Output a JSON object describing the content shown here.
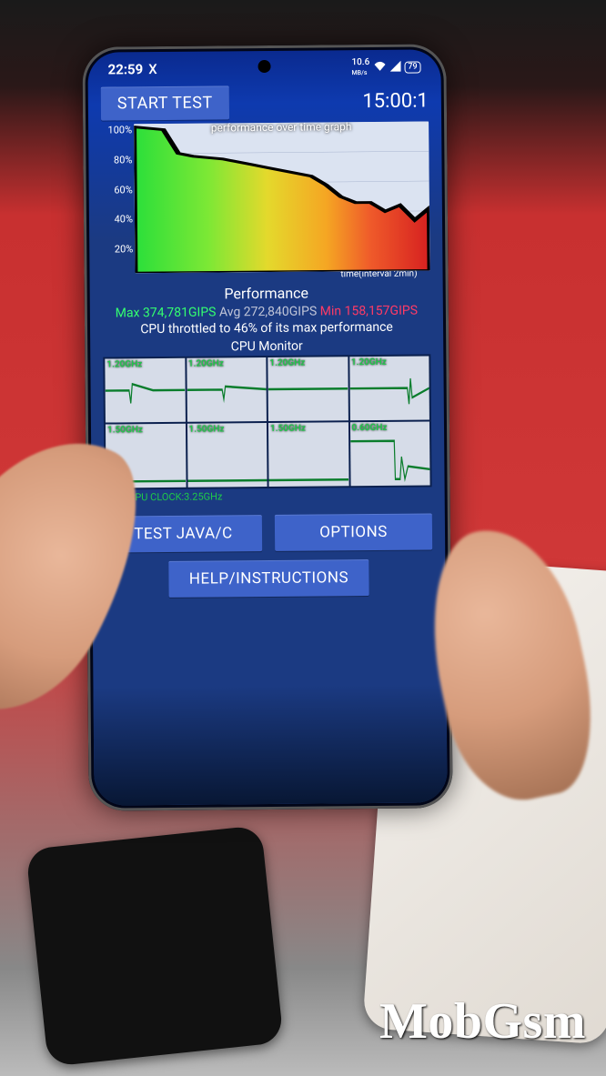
{
  "statusbar": {
    "time": "22:59",
    "carrier_icon": "X",
    "net_speed": "10.6",
    "net_unit": "MB/s",
    "battery_pct": "79"
  },
  "toolbar": {
    "start_label": "START TEST",
    "duration": "15:00:1"
  },
  "chart": {
    "title": "performance over time graph",
    "xaxis_label": "time(interval 2min)"
  },
  "chart_data": {
    "type": "area",
    "title": "performance over time graph",
    "xlabel": "time (interval 2min)",
    "ylabel": "%",
    "ylim": [
      0,
      100
    ],
    "yticks": [
      "100%",
      "80%",
      "60%",
      "40%",
      "20%"
    ],
    "x": [
      0,
      5,
      10,
      15,
      20,
      25,
      30,
      35,
      40,
      45,
      50,
      55,
      60,
      65,
      70,
      75,
      80,
      85,
      90,
      95,
      100
    ],
    "values": [
      98,
      97,
      96,
      80,
      78,
      77,
      76,
      74,
      72,
      70,
      68,
      66,
      64,
      58,
      50,
      46,
      46,
      40,
      44,
      34,
      42
    ]
  },
  "performance": {
    "header": "Performance",
    "max_label": "Max 374,781GIPS",
    "avg_label": "Avg 272,840GIPS",
    "min_label": "Min 158,157GIPS",
    "throttle_text": "CPU throttled to 46% of its max performance"
  },
  "cpu_monitor": {
    "title": "CPU Monitor",
    "max_clock_label": "MAX CPU CLOCK:3.25GHz",
    "cores": [
      {
        "freq": "1.20GHz"
      },
      {
        "freq": "1.20GHz"
      },
      {
        "freq": "1.20GHz"
      },
      {
        "freq": "1.20GHz"
      },
      {
        "freq": "1.50GHz"
      },
      {
        "freq": "1.50GHz"
      },
      {
        "freq": "1.50GHz"
      },
      {
        "freq": "0.60GHz"
      }
    ]
  },
  "buttons": {
    "test_java": "TEST JAVA/C",
    "options": "OPTIONS",
    "help": "HELP/INSTRUCTIONS"
  },
  "watermark": "MobGsm"
}
